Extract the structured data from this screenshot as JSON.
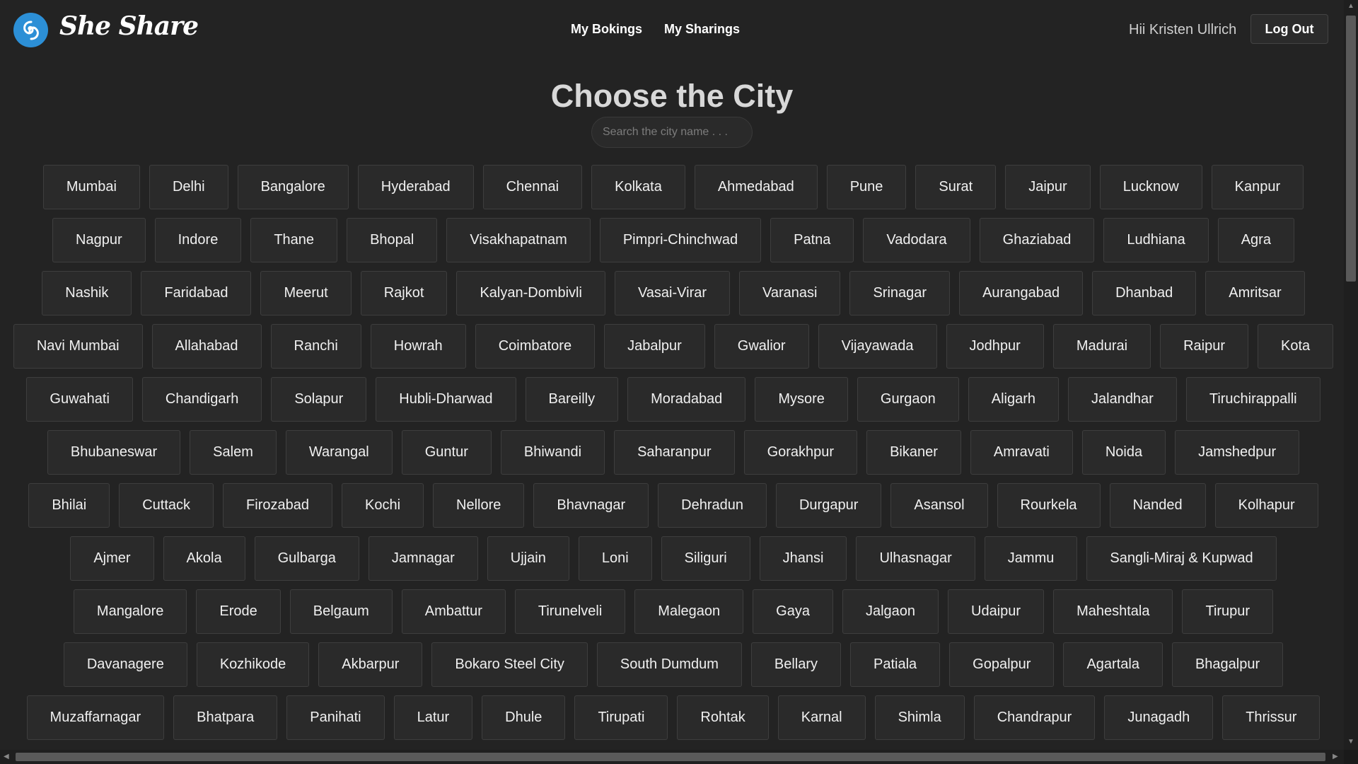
{
  "brand": {
    "name": "She Share",
    "logo_icon": "swirl-logo-icon"
  },
  "nav": {
    "bookings": "My Bokings",
    "sharings": "My Sharings"
  },
  "user": {
    "greeting": "Hii Kristen Ullrich",
    "logout": "Log Out"
  },
  "page": {
    "title": "Choose the City"
  },
  "search": {
    "placeholder": "Search the city name . . .",
    "value": ""
  },
  "cities": [
    [
      "Mumbai",
      "Delhi",
      "Bangalore",
      "Hyderabad",
      "Chennai",
      "Kolkata",
      "Ahmedabad",
      "Pune",
      "Surat",
      "Jaipur",
      "Lucknow",
      "Kanpur"
    ],
    [
      "Nagpur",
      "Indore",
      "Thane",
      "Bhopal",
      "Visakhapatnam",
      "Pimpri-Chinchwad",
      "Patna",
      "Vadodara",
      "Ghaziabad",
      "Ludhiana",
      "Agra"
    ],
    [
      "Nashik",
      "Faridabad",
      "Meerut",
      "Rajkot",
      "Kalyan-Dombivli",
      "Vasai-Virar",
      "Varanasi",
      "Srinagar",
      "Aurangabad",
      "Dhanbad",
      "Amritsar"
    ],
    [
      "Navi Mumbai",
      "Allahabad",
      "Ranchi",
      "Howrah",
      "Coimbatore",
      "Jabalpur",
      "Gwalior",
      "Vijayawada",
      "Jodhpur",
      "Madurai",
      "Raipur",
      "Kota"
    ],
    [
      "Guwahati",
      "Chandigarh",
      "Solapur",
      "Hubli-Dharwad",
      "Bareilly",
      "Moradabad",
      "Mysore",
      "Gurgaon",
      "Aligarh",
      "Jalandhar",
      "Tiruchirappalli"
    ],
    [
      "Bhubaneswar",
      "Salem",
      "Warangal",
      "Guntur",
      "Bhiwandi",
      "Saharanpur",
      "Gorakhpur",
      "Bikaner",
      "Amravati",
      "Noida",
      "Jamshedpur"
    ],
    [
      "Bhilai",
      "Cuttack",
      "Firozabad",
      "Kochi",
      "Nellore",
      "Bhavnagar",
      "Dehradun",
      "Durgapur",
      "Asansol",
      "Rourkela",
      "Nanded",
      "Kolhapur"
    ],
    [
      "Ajmer",
      "Akola",
      "Gulbarga",
      "Jamnagar",
      "Ujjain",
      "Loni",
      "Siliguri",
      "Jhansi",
      "Ulhasnagar",
      "Jammu",
      "Sangli-Miraj & Kupwad"
    ],
    [
      "Mangalore",
      "Erode",
      "Belgaum",
      "Ambattur",
      "Tirunelveli",
      "Malegaon",
      "Gaya",
      "Jalgaon",
      "Udaipur",
      "Maheshtala",
      "Tirupur"
    ],
    [
      "Davanagere",
      "Kozhikode",
      "Akbarpur",
      "Bokaro Steel City",
      "South Dumdum",
      "Bellary",
      "Patiala",
      "Gopalpur",
      "Agartala",
      "Bhagalpur"
    ],
    [
      "Muzaffarnagar",
      "Bhatpara",
      "Panihati",
      "Latur",
      "Dhule",
      "Tirupati",
      "Rohtak",
      "Karnal",
      "Shimla",
      "Chandrapur",
      "Junagadh",
      "Thrissur"
    ]
  ],
  "colors": {
    "background": "#232323",
    "button": "#2a2a2a",
    "accent": "#2c8fd6"
  }
}
